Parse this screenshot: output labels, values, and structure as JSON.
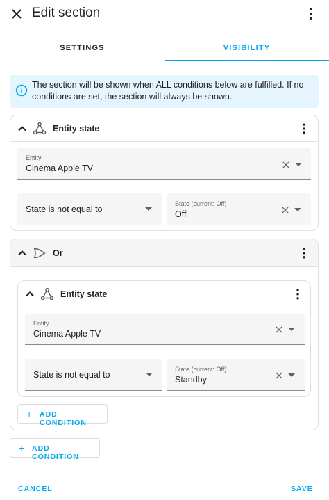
{
  "header": {
    "title": "Edit section",
    "close_icon": "close-icon",
    "menu_icon": "more-vert-icon"
  },
  "tabs": [
    {
      "label": "SETTINGS",
      "active": false
    },
    {
      "label": "VISIBILITY",
      "active": true
    }
  ],
  "info": {
    "text": "The section will be shown when ALL conditions below are fulfilled. If no conditions are set, the section will always be shown."
  },
  "conditions": [
    {
      "title": "Entity state",
      "entity_label": "Entity",
      "entity_value": "Cinema Apple TV",
      "operator": "State is not equal to",
      "state_label": "State (current: Off)",
      "state_value": "Off"
    },
    {
      "title": "Or",
      "nested": {
        "title": "Entity state",
        "entity_label": "Entity",
        "entity_value": "Cinema Apple TV",
        "operator": "State is not equal to",
        "state_label": "State (current: Off)",
        "state_value": "Standby"
      },
      "add_label": "ADD CONDITION"
    }
  ],
  "add_condition_label": "ADD CONDITION",
  "footer": {
    "cancel_label": "CANCEL",
    "save_label": "SAVE"
  },
  "colors": {
    "accent": "#03a9f4",
    "info_bg": "#e5f5fe",
    "field_bg": "#f5f5f5"
  }
}
